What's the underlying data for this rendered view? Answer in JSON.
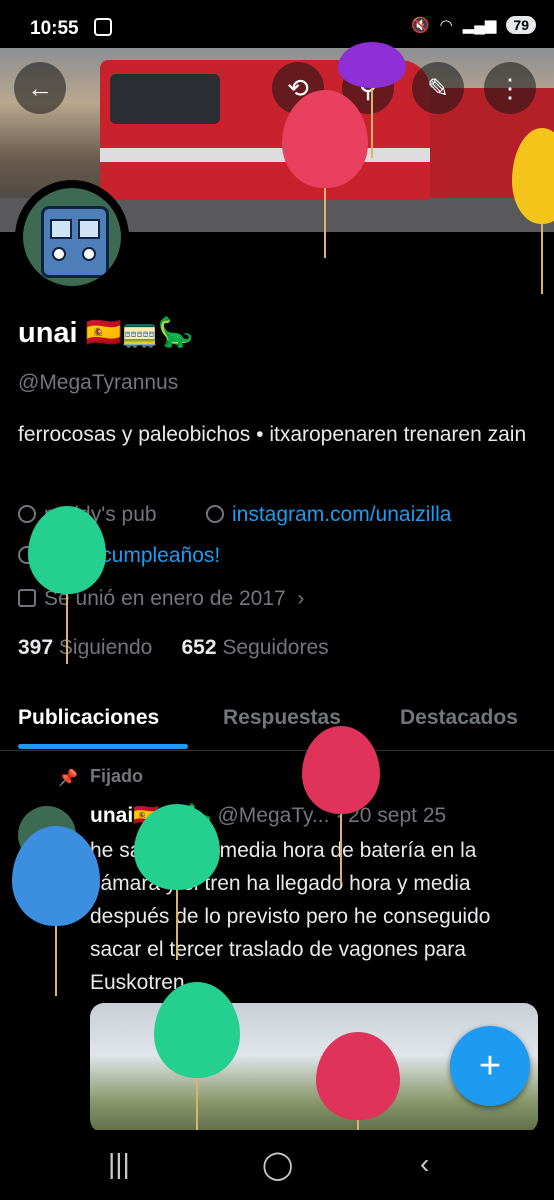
{
  "status_bar": {
    "time": "10:55",
    "battery": "79"
  },
  "header": {
    "back_icon": "arrow-left-icon",
    "actions": [
      "refresh-icon",
      "search-icon",
      "edit-icon",
      "more-vertical-icon"
    ]
  },
  "profile": {
    "name": "unai",
    "handle": "@MegaTyrannus",
    "bio": "ferrocosas y paleobichos • itxaropenaren trenaren zain",
    "location": "paddy's pub",
    "website": "instagram.com/unaizilla",
    "birthday": "¡Feliz cumpleaños!",
    "joined": "Se unió en enero de 2017",
    "following_count": "397",
    "following_label": "Siguiendo",
    "followers_count": "652",
    "followers_label": "Seguidores"
  },
  "tabs": [
    "Publicaciones",
    "Respuestas",
    "Destacados"
  ],
  "pinned_post": {
    "pinned_label": "Fijado",
    "author": "unai",
    "handle": "@MegaTy...",
    "date": "· 20 sept 25",
    "text": "he salido con media hora de batería en la cámara y el tren ha llegado hora y media después de lo previsto pero he conseguido sacar el tercer traslado de vagones para Euskotren"
  },
  "fab_label": "+",
  "colors": {
    "accent": "#1d9bf0",
    "background": "#000000",
    "muted": "#71767b"
  }
}
